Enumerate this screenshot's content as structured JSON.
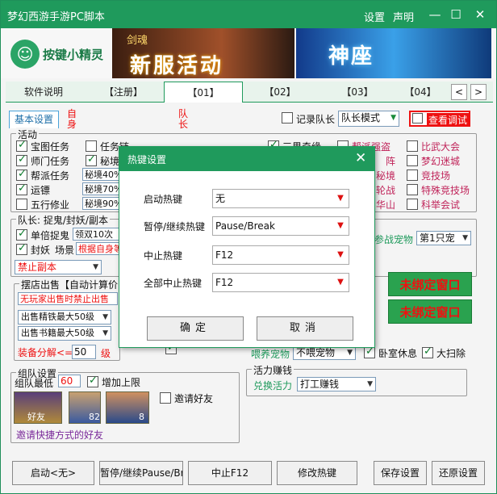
{
  "app": {
    "title": "梦幻西游手游PC脚本",
    "links": [
      "设置",
      "声明"
    ],
    "controls": [
      "—",
      "☐",
      "✕"
    ]
  },
  "logo": {
    "text": "按键小精灵"
  },
  "ads": {
    "left_small": "剑魂",
    "left_big": "新服活动",
    "right_big": "神座"
  },
  "tabs": [
    "软件说明",
    "【注册】",
    "【01】",
    "【02】",
    "【03】",
    "【04】"
  ],
  "tab_arrows": [
    "<",
    ">"
  ],
  "subtabs": {
    "basic": "基本设置",
    "self": "自身",
    "leader": "队长",
    "record_leader": "记录队长",
    "leader_mode": "队长模式",
    "debug": "查看调试"
  },
  "activity": {
    "title": "活动",
    "items": [
      {
        "label": "宝图任务",
        "on": true
      },
      {
        "label": "任务链",
        "on": false
      },
      {
        "label": "三界奇缘",
        "on": true
      },
      {
        "label": "帮派强盗",
        "on": false
      },
      {
        "label": "比武大会",
        "on": false
      },
      {
        "label": "师门任务",
        "on": true
      },
      {
        "label": "秘境降妖",
        "on": true
      },
      {
        "label": "阵",
        "on": false
      },
      {
        "label": "梦幻迷城",
        "on": false
      },
      {
        "label": "帮派任务",
        "on": true
      },
      {
        "label": "秘境",
        "on": false
      },
      {
        "label": "竞技场",
        "on": false
      },
      {
        "label": "运镖",
        "on": true
      },
      {
        "label": "轮战",
        "on": false
      },
      {
        "label": "特殊竞技场",
        "on": false
      },
      {
        "label": "五行修业",
        "on": false
      },
      {
        "label": "华山",
        "on": false
      },
      {
        "label": "科举会试",
        "on": false
      }
    ],
    "fields": [
      "秘境40%",
      "秘境70%",
      "秘境90%"
    ]
  },
  "leader_sec": {
    "title": "队长: 捉鬼/封妖/副本",
    "single": "单倍捉鬼",
    "single_val": "领双10次",
    "seal": "封妖",
    "scene": "场景",
    "scene_val": "根据自身等",
    "ban": "禁止副本",
    "pet_label": "参战宠物",
    "pet_val": "第1只宠"
  },
  "stall": {
    "title": "摆店出售【自动计算价格",
    "notice": "无玩家出售时禁止出售",
    "sell1": "出售精铁最大50级",
    "sell2": "出售书籍最大50级",
    "decompose": "装备分解<=",
    "level": "50",
    "unit": "级"
  },
  "green_btns": [
    "未绑定窗口",
    "未绑定窗口"
  ],
  "pet_rest": {
    "feed": "喂养宠物",
    "feed_val": "不喂宠物",
    "rest": "卧室休息",
    "sweep": "大扫除"
  },
  "vitality": {
    "title": "活力赚钱",
    "label": "兑换活力",
    "val": "打工赚钱"
  },
  "team": {
    "title": "组队设置",
    "min_label": "组队最低",
    "min_val": "60",
    "limit": "增加上限",
    "invite": "邀请好友",
    "note": "邀请快捷方式的好友",
    "friend": "好友",
    "lv1": "82",
    "lv2": "8"
  },
  "bottom": [
    "启动<无>",
    "暂停/继续Pause/Break",
    "中止F12",
    "修改热键",
    "保存设置",
    "还原设置"
  ],
  "modal": {
    "title": "热键设置",
    "rows": [
      {
        "label": "启动热键",
        "value": "无"
      },
      {
        "label": "暂停/继续热键",
        "value": "Pause/Break"
      },
      {
        "label": "中止热键",
        "value": "F12"
      },
      {
        "label": "全部中止热键",
        "value": "F12"
      }
    ],
    "ok": "确定",
    "cancel": "取消"
  }
}
